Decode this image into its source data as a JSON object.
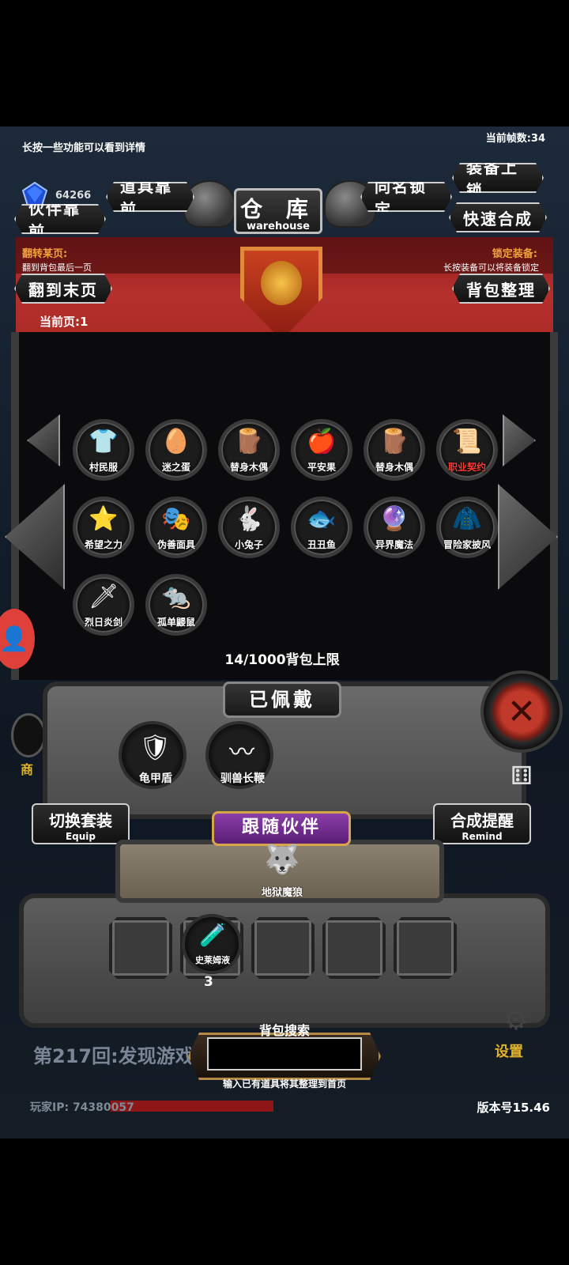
{
  "hud": {
    "hint": "长按一些功能可以看到详情",
    "fps": "当前帧数:34",
    "gem_count": "64266"
  },
  "header": {
    "title_cn": "仓 库",
    "title_en": "warehouse",
    "btn_items_front": "道具靠前",
    "btn_partner_front": "伙伴靠前",
    "btn_same_name_lock": "同名锁定",
    "btn_equip_lock": "装备上锁",
    "btn_quick_merge": "快速合成",
    "flip_title": "翻转某页:",
    "flip_hint": "翻到背包最后一页",
    "lock_title": "锁定装备:",
    "lock_hint": "长按装备可以将装备锁定",
    "btn_last_page": "翻到末页",
    "btn_sort_bag": "背包整理",
    "current_page": "当前页:1"
  },
  "inventory": {
    "items": [
      {
        "label": "村民服",
        "icon": "shirt-icon",
        "glyph": "👕",
        "color": "#ffffff"
      },
      {
        "label": "迷之蛋",
        "icon": "egg-icon",
        "glyph": "🥚",
        "color": "#ffffff"
      },
      {
        "label": "替身木偶",
        "icon": "wooden-doll-icon",
        "glyph": "🪵",
        "color": "#ffffff"
      },
      {
        "label": "平安果",
        "icon": "apple-icon",
        "glyph": "🍎",
        "color": "#ffffff"
      },
      {
        "label": "替身木偶",
        "icon": "wooden-doll-icon",
        "glyph": "🪵",
        "color": "#ffffff"
      },
      {
        "label": "职业契约",
        "icon": "scroll-icon",
        "glyph": "📜",
        "color": "#ff3b30"
      },
      {
        "label": "希望之力",
        "icon": "star-icon",
        "glyph": "⭐",
        "color": "#ffffff"
      },
      {
        "label": "伪善面具",
        "icon": "mask-icon",
        "glyph": "🎭",
        "color": "#ffffff"
      },
      {
        "label": "小兔子",
        "icon": "rabbit-icon",
        "glyph": "🐇",
        "color": "#ffffff"
      },
      {
        "label": "丑丑鱼",
        "icon": "fish-icon",
        "glyph": "🐟",
        "color": "#ffffff"
      },
      {
        "label": "异界魔法",
        "icon": "magic-icon",
        "glyph": "🔮",
        "color": "#ffffff"
      },
      {
        "label": "冒险家披风",
        "icon": "cape-icon",
        "glyph": "🧥",
        "color": "#ffffff"
      },
      {
        "label": "烈日炎剑",
        "icon": "sword-icon",
        "glyph": "🗡",
        "color": "#ffffff"
      },
      {
        "label": "孤单鼹鼠",
        "icon": "mole-icon",
        "glyph": "🐀",
        "color": "#ffffff"
      }
    ],
    "capacity": "14/1000背包上限"
  },
  "equipped": {
    "title": "已佩戴",
    "items": [
      {
        "label": "龟甲盾",
        "icon": "turtle-shield-icon",
        "glyph": "🛡"
      },
      {
        "label": "驯兽长鞭",
        "icon": "whip-icon",
        "glyph": "〰"
      }
    ],
    "switch_set_cn": "切换套装",
    "switch_set_en": "Equip",
    "merge_remind_cn": "合成提醒",
    "merge_remind_en": "Remind"
  },
  "partner": {
    "title": "跟随伙伴",
    "name": "地狱魔狼",
    "icon": "hell-wolf-icon",
    "glyph": "🐺"
  },
  "potions": {
    "item_label": "史莱姆液",
    "icon": "potion-icon",
    "glyph": "🧪",
    "count": "3"
  },
  "footer": {
    "chapter": "第217回:发现游戏",
    "search_label": "背包搜索",
    "search_value": "",
    "search_hint": "输入已有道具将其整理到首页",
    "settings": "设置",
    "shop": "商",
    "player_ip": "玩家IP:  74380057",
    "version": "版本号15.46"
  }
}
